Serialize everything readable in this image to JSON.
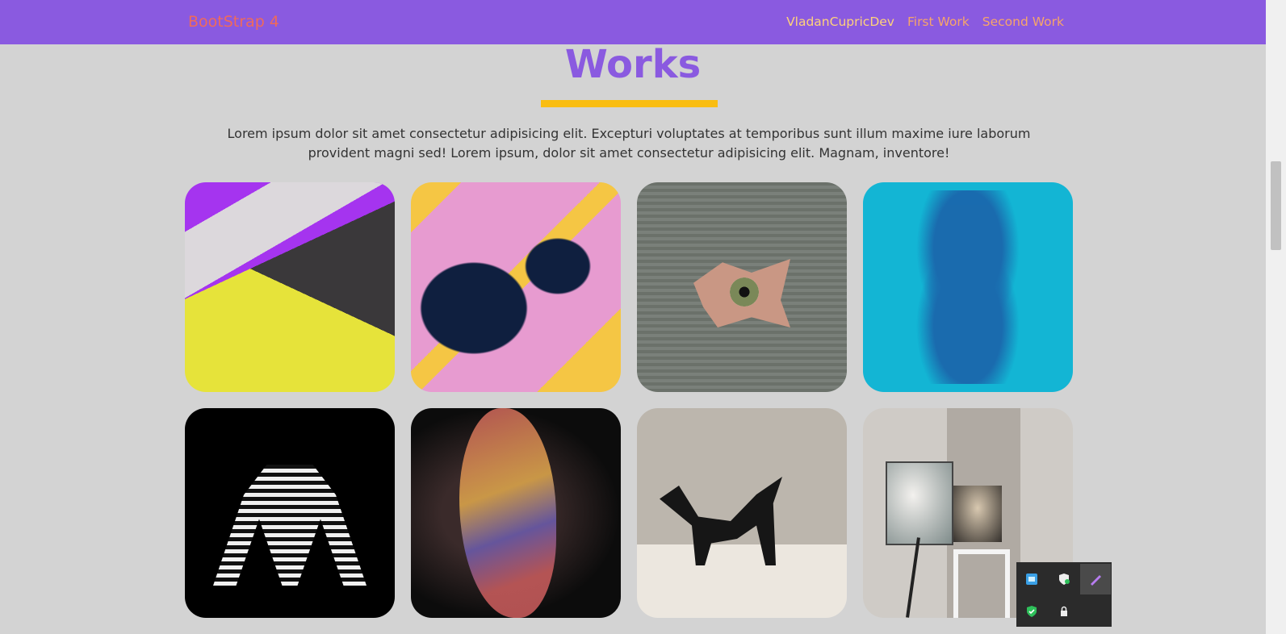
{
  "navbar": {
    "brand": "BootStrap 4",
    "links": [
      "VladanCupricDev",
      "First Work",
      "Second Work"
    ]
  },
  "section": {
    "title": "Works",
    "lead": "Lorem ipsum dolor sit amet consectetur adipisicing elit. Excepturi voluptates at temporibus sunt illum maxime iure laborum provident magni sed! Lorem ipsum, dolor sit amet consectetur adipisicing elit. Magnam, inventore!"
  },
  "gallery": {
    "images": [
      {
        "name": "abstract-paper-colors"
      },
      {
        "name": "pink-yellow-fluid-art"
      },
      {
        "name": "eye-through-torn-paper"
      },
      {
        "name": "blue-mirrored-tree"
      },
      {
        "name": "striped-body-art"
      },
      {
        "name": "tattoo-leg"
      },
      {
        "name": "black-metal-sculpture"
      },
      {
        "name": "art-studio-easel"
      }
    ]
  },
  "colors": {
    "navbar_bg": "#8a5ae0",
    "title": "#8a5ae0",
    "underline": "#f9bd12",
    "page_bg": "#d3d3d3"
  },
  "system_tray": {
    "icons": [
      "app-blue-icon",
      "security-shield-icon",
      "pen-icon",
      "shield-check-icon",
      "network-lock-icon"
    ]
  }
}
